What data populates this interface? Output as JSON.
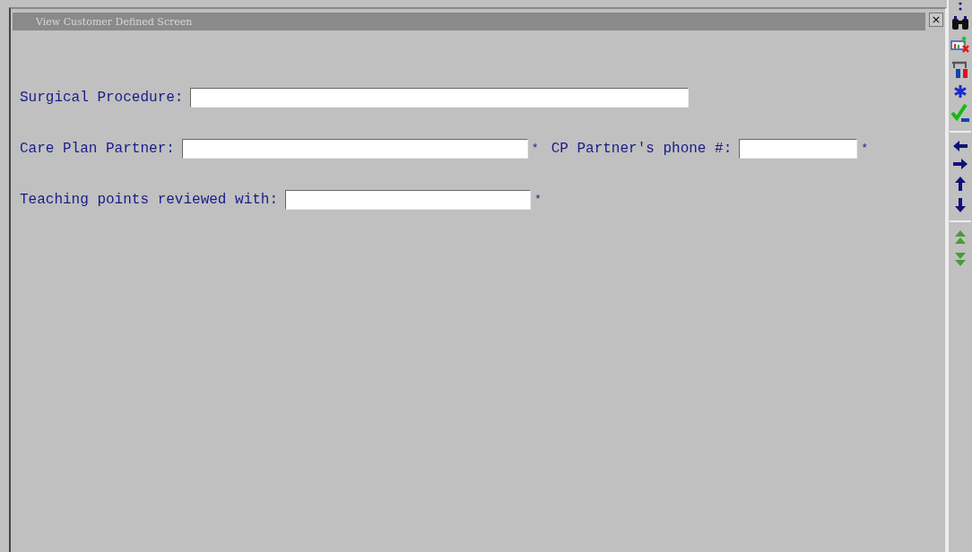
{
  "window": {
    "title": "View Customer Defined Screen",
    "close": "×"
  },
  "form_rows": [
    {
      "fields": [
        {
          "label": "Surgical Procedure:"
        }
      ]
    },
    {
      "fields": [
        {
          "label": "Care Plan Partner:",
          "marker": "*"
        },
        {
          "label": "CP Partner's phone #:",
          "marker": "*"
        }
      ]
    },
    {
      "fields": [
        {
          "label": "Teaching points reviewed with:",
          "marker": "*"
        }
      ]
    }
  ]
}
